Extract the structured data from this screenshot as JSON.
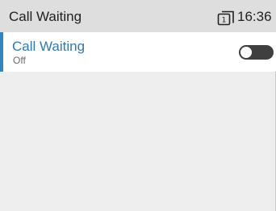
{
  "header": {
    "title": "Call Waiting",
    "line_indicator": "1",
    "time": "16:36"
  },
  "settings": {
    "items": [
      {
        "label": "Call Waiting",
        "value": "Off",
        "enabled": false
      }
    ]
  },
  "icons": {
    "line": "line-1-icon"
  },
  "colors": {
    "accent": "#2f84c3",
    "label_blue": "#2f79b8",
    "background": "#eeeeee",
    "statusbar": "#dedede",
    "toggle_off": "#3f3f3f"
  }
}
